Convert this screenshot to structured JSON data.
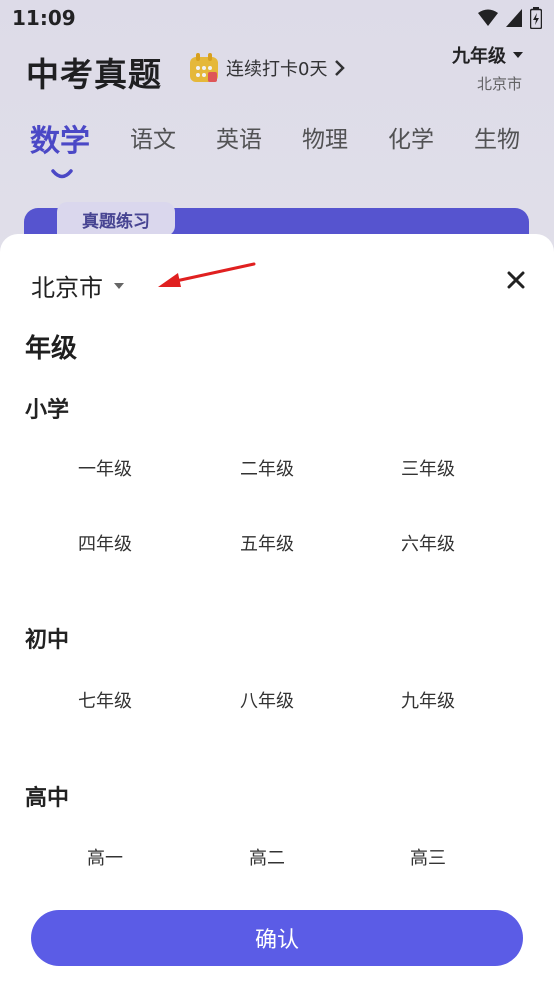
{
  "status_bar": {
    "time": "11:09"
  },
  "header": {
    "title": "中考真题",
    "checkin_text": "连续打卡0天",
    "grade": "九年级",
    "city": "北京市"
  },
  "subjects": [
    "数学",
    "语文",
    "英语",
    "物理",
    "化学",
    "生物"
  ],
  "active_subject": "数学",
  "practice_tag": "真题练习",
  "sheet": {
    "city": "北京市",
    "heading": "年级",
    "sections": [
      {
        "title": "小学",
        "grades": [
          "一年级",
          "二年级",
          "三年级",
          "四年级",
          "五年级",
          "六年级"
        ]
      },
      {
        "title": "初中",
        "grades": [
          "七年级",
          "八年级",
          "九年级"
        ]
      },
      {
        "title": "高中",
        "grades": [
          "高一",
          "高二",
          "高三"
        ]
      }
    ],
    "confirm_label": "确认"
  },
  "colors": {
    "accent": "#5b5ce6",
    "active_tab": "#4e4bcf",
    "annotation_arrow": "#e02020"
  }
}
